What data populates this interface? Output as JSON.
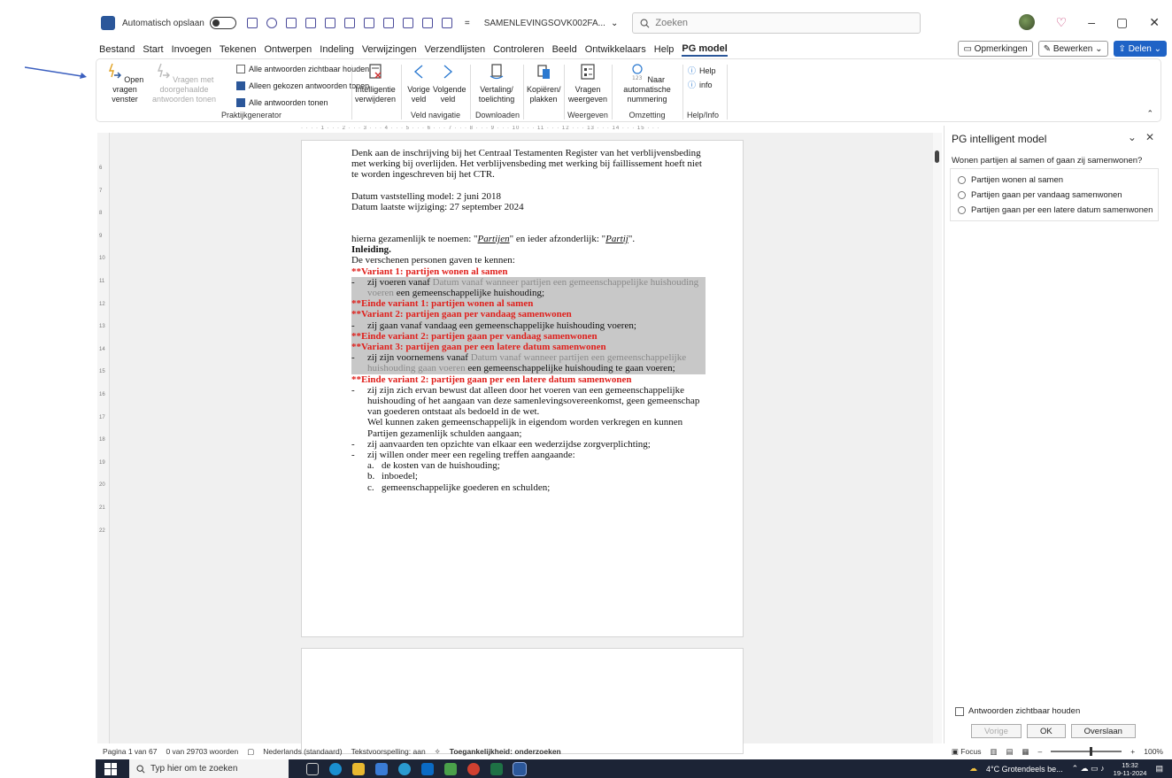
{
  "titlebar": {
    "autosave_label": "Automatisch opslaan",
    "document_name": "SAMENLEVINGSOVK002FA...",
    "search_placeholder": "Zoeken"
  },
  "menu": {
    "items": [
      "Bestand",
      "Start",
      "Invoegen",
      "Tekenen",
      "Ontwerpen",
      "Indeling",
      "Verwijzingen",
      "Verzendlijsten",
      "Controleren",
      "Beeld",
      "Ontwikkelaars",
      "Help",
      "PG model"
    ],
    "active": "PG model",
    "comments_label": "Opmerkingen",
    "edit_label": "Bewerken",
    "share_label": "Delen"
  },
  "ribbon": {
    "open_questions": "Open vragen venster",
    "questions_forwarded": "Vragen met doorgehaalde antwoorden tonen",
    "keep_all_visible": "Alle antwoorden zichtbaar houden",
    "only_chosen": "Alleen gekozen antwoorden tonen",
    "all_answers": "Alle antwoorden tonen",
    "group_praktijk": "Praktijkgenerator",
    "intelligence_remove": "Intelligentie verwijderen",
    "prev_field": "Vorige veld",
    "next_field": "Volgende veld",
    "group_nav": "Veld navigatie",
    "translation": "Vertaling/ toelichting",
    "group_download": "Downloaden",
    "copy_paste": "Kopiëren/ plakken",
    "show_questions": "Vragen weergeven",
    "group_display": "Weergeven",
    "auto_numbering": "Naar automatische nummering",
    "group_convert": "Omzetting",
    "help": "Help",
    "info": "info",
    "group_help": "Help/Info"
  },
  "ruler": {
    "vertical_marks": [
      "6",
      "7",
      "8",
      "9",
      "10",
      "11",
      "12",
      "13",
      "14",
      "15",
      "16",
      "17",
      "18",
      "19",
      "20",
      "21",
      "22"
    ]
  },
  "document": {
    "intro": "Denk aan de inschrijving bij het Centraal Testamenten Register van het verblijvensbeding met werking bij overlijden. Het verblijvensbeding met werking bij faillissement hoeft niet te worden ingeschreven bij het CTR.",
    "date_model": "Datum vaststelling model: 2 juni 2018",
    "date_changed": "Datum laatste wijziging: 27 september 2024",
    "named_pre": "hierna gezamenlijk te noemen: \"",
    "named_partijen": "Partijen",
    "named_mid": "\" en ieder afzonderlijk: \"",
    "named_partij": "Partij",
    "named_post": "\".",
    "heading": "Inleiding.",
    "known": "De verschenen personen gaven te kennen:",
    "v1_start": "**Variant 1: partijen wonen al samen",
    "v1_a": "zij voeren vanaf ",
    "v1_field": "Datum vanaf wanneer partijen een gemeenschappelijke huishouding voeren",
    "v1_b": " een gemeenschappelijke huishouding;",
    "v1_end": "**Einde variant 1: partijen wonen al samen",
    "v2_start": "**Variant 2: partijen gaan per vandaag samenwonen",
    "v2_text": "zij gaan vanaf vandaag een gemeenschappelijke huishouding voeren;",
    "v2_end": "**Einde variant 2: partijen gaan per vandaag samenwonen",
    "v3_start": "**Variant 3: partijen gaan per een latere datum samenwonen",
    "v3_a": "zij zijn voornemens vanaf ",
    "v3_field": "Datum vanaf wanneer partijen een gemeenschappelijke huishouding gaan voeren",
    "v3_b": " een gemeenschappelijke huishouding te gaan voeren;",
    "v3_end": "**Einde variant 2: partijen gaan per een latere datum samenwonen",
    "b1": "zij zijn zich ervan bewust dat alleen door het voeren van een gemeenschappelijke huishouding of het aangaan van deze samenlevingsovereenkomst, geen gemeenschap van goederen ontstaat als bedoeld in de wet.",
    "b1_cont": "Wel kunnen zaken gemeenschappelijk in eigendom worden verkregen en kunnen Partijen gezamenlijk schulden aangaan;",
    "b2": "zij aanvaarden ten opzichte van elkaar een wederzijdse zorgverplichting;",
    "b3": "zij willen onder meer een regeling treffen aangaande:",
    "sub_a": "de kosten van de huishouding;",
    "sub_b": "inboedel;",
    "sub_c": "gemeenschappelijke goederen en schulden;"
  },
  "pane": {
    "title": "PG intelligent model",
    "question": "Wonen partijen al samen of gaan zij samenwonen?",
    "options": [
      "Partijen wonen al samen",
      "Partijen gaan per vandaag samenwonen",
      "Partijen gaan per een latere datum samenwonen"
    ],
    "keep_visible": "Antwoorden zichtbaar houden",
    "prev": "Vorige",
    "ok": "OK",
    "skip": "Overslaan"
  },
  "status": {
    "page": "Pagina 1 van 67",
    "words": "0 van 29703 woorden",
    "language": "Nederlands (standaard)",
    "predictions": "Tekstvoorspelling: aan",
    "accessibility": "Toegankelijkheid: onderzoeken",
    "focus": "Focus",
    "zoom": "100%"
  },
  "taskbar": {
    "search_placeholder": "Typ hier om te zoeken",
    "weather": "4°C  Grotendeels be...",
    "time": "15:32",
    "date": "19-11-2024"
  },
  "colors": {
    "accent": "#2b579a",
    "variant_red": "#e0201c",
    "highlight": "#c8c8c8"
  }
}
